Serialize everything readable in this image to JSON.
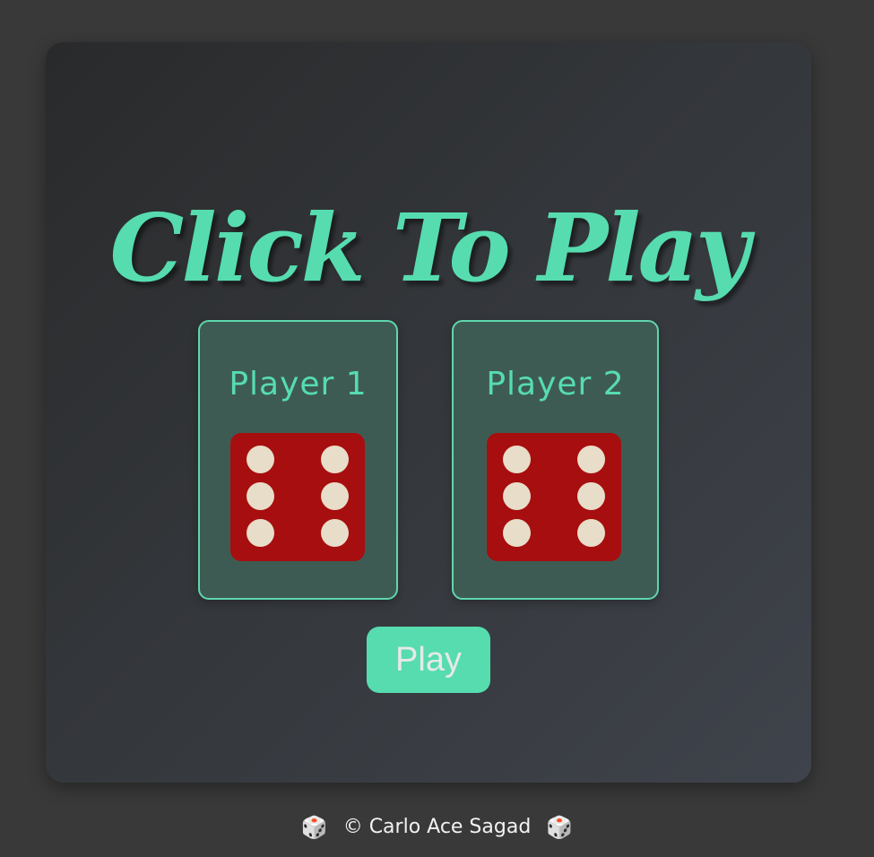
{
  "title": "Click To Play",
  "players": [
    {
      "label": "Player 1",
      "die_face": 6
    },
    {
      "label": "Player 2",
      "die_face": 6
    }
  ],
  "play_button_label": "Play",
  "footer": {
    "text": "© Carlo Ace Sagad",
    "icon": "game-die-icon",
    "icon_glyph": "🎲"
  },
  "colors": {
    "accent": "#56dcaf",
    "die": "#a70e0f",
    "pip": "#e8ddc8",
    "background": "#393939"
  }
}
